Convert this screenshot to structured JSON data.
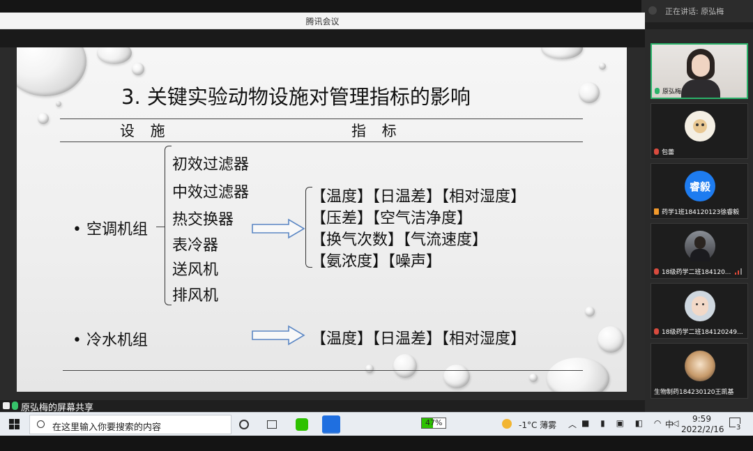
{
  "window": {
    "title": "腾讯会议"
  },
  "speaking": {
    "text": "正在讲话: 原弘梅"
  },
  "slide": {
    "title": "3.  关键实验动物设施对管理指标的影响",
    "col_facility": "设 施",
    "col_indicator": "指 标",
    "group1": {
      "bullet": "• 空调机组",
      "items": [
        "初效过滤器",
        "中效过滤器",
        "热交换器",
        "表冷器",
        "送风机",
        "排风机"
      ],
      "indicators": [
        "【温度】【日温差】【相对湿度】",
        "【压差】【空气洁净度】",
        "【换气次数】【气流速度】",
        "【氨浓度】【噪声】"
      ]
    },
    "group2": {
      "bullet": "• 冷水机组",
      "indicators": [
        "【温度】【日温差】【相对湿度】"
      ]
    }
  },
  "share_label": "原弘梅的屏幕共享",
  "participants": [
    {
      "name": "原弘梅",
      "mic": "on",
      "kind": "video"
    },
    {
      "name": "包蕾",
      "mic": "muted",
      "kind": "cartoon"
    },
    {
      "name": "药学1班184120123徐睿毅",
      "mic": "none",
      "kind": "text",
      "avatar_text": "睿毅",
      "avatar_color": "#1e7cf0"
    },
    {
      "name": "18级药学二班184120...",
      "mic": "muted",
      "kind": "photo"
    },
    {
      "name": "18级药学二班184120249...",
      "mic": "muted",
      "kind": "baby"
    },
    {
      "name": "生物制药184230120王凯基",
      "mic": "none",
      "kind": "photo2"
    }
  ],
  "taskbar": {
    "search_placeholder": "在这里输入你要搜索的内容",
    "battery": "47%",
    "weather": "-1°C  薄雾",
    "ime": "中",
    "time": "9:59",
    "date": "2022/2/16",
    "notifications": "3"
  }
}
